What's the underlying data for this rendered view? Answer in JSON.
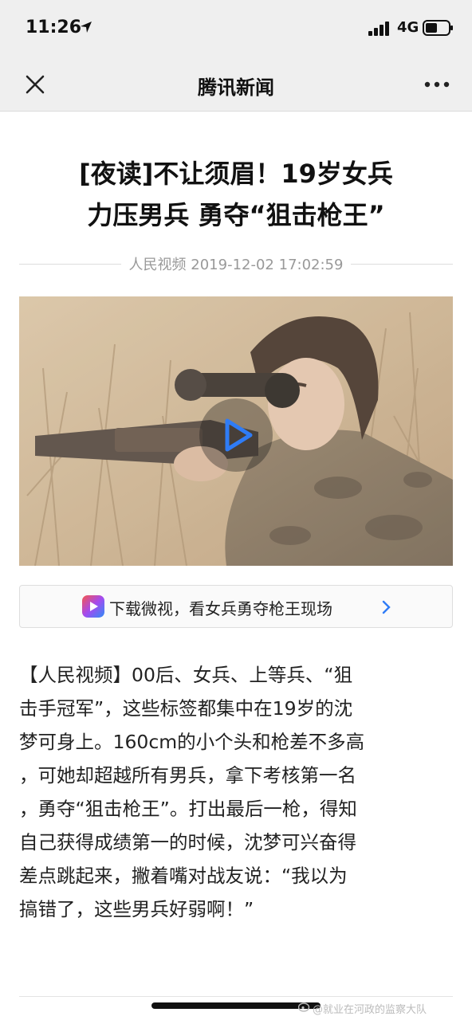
{
  "status_bar": {
    "time": "11:26",
    "network": "4G",
    "icons": [
      "location-arrow-icon",
      "signal-icon",
      "battery-icon"
    ]
  },
  "nav": {
    "title": "腾讯新闻",
    "close_icon": "close-icon",
    "more_icon": "more-icon"
  },
  "article": {
    "title_line1": "[夜读]不让须眉！19岁女兵",
    "title_line2": "力压男兵 勇夺“狙击枪王”",
    "source": "人民视频",
    "datetime": "2019-12-02 17:02:59"
  },
  "video": {
    "play_icon": "play-icon"
  },
  "download_banner": {
    "text": "下载微视，看女兵勇夺枪王现场",
    "chevron": ">",
    "app_icon": "weishi-app-icon"
  },
  "body": {
    "paragraph": "【人民视频】00后、女兵、上等兵、“狙\n击手冠军”，这些标签都集中在19岁的沈\n梦可身上。160cm的小个头和枪差不多高\n，可她却超越所有男兵，拿下考核第一名\n，勇夺“狙击枪王”。打出最后一枪，得知\n自己获得成绩第一的时候，沈梦可兴奋得\n差点跳起来，撇着嘴对战友说：“我以为\n搞错了，这些男兵好弱啊！”"
  },
  "watermark": {
    "text": "@就业在河政的监察大队"
  },
  "colors": {
    "bar_background": "#efefef",
    "meta_text": "#999999",
    "play_blue": "#2f7cf6"
  }
}
